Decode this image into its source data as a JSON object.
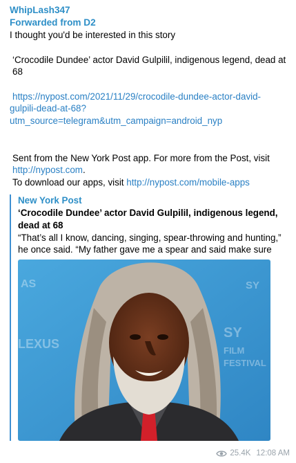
{
  "message": {
    "sender": "WhipLash347",
    "forwarded_from": "Forwarded from D2",
    "intro": "I thought you'd be interested in this story",
    "headline": "‘Crocodile Dundee’ actor David Gulpilil, indigenous legend, dead at 68",
    "url_line_1": "https://nypost.com/2021/11/29/crocodile-dundee-actor-david-",
    "url_line_2": "gulpili-dead-at-68?",
    "url_line_3": "utm_source=telegram&utm_campaign=android_nyp",
    "sent_from_text": "Sent from the New York Post app. For more from the Post, visit",
    "post_link": "http://nypost.com",
    "post_link_suffix": ".",
    "download_text": "To download our apps, visit ",
    "apps_link": "http://nypost.com/mobile-apps"
  },
  "preview": {
    "site_name": "New York Post",
    "title": "‘Crocodile Dundee’ actor David Gulpilil, indigenous legend, dead at 68",
    "description": "“That’s all I know, dancing, singing, spear-throwing and hunting,” he once said. “My father gave me a spear and said make sure yo…",
    "image_alt": "David Gulpilil"
  },
  "meta": {
    "views": "25.4K",
    "time": "12:08 AM",
    "view_icon": "eye-icon"
  },
  "colors": {
    "accent": "#2e8fc7",
    "link": "#2a80c4",
    "preview_bar": "#3d8fd1",
    "meta_text": "#9aa3ab"
  }
}
